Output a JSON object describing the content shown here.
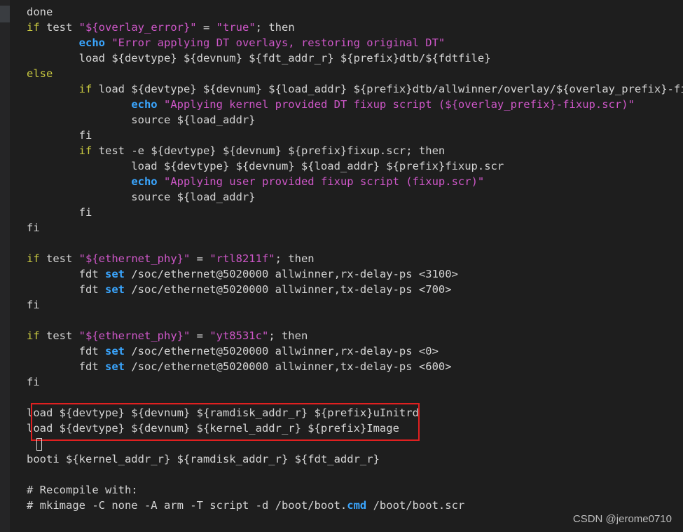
{
  "editor": {
    "lines": [
      [
        {
          "t": "done",
          "c": "plain"
        }
      ],
      [
        {
          "t": "if",
          "c": "kw"
        },
        {
          "t": " test ",
          "c": "plain"
        },
        {
          "t": "\"${overlay_error}\"",
          "c": "str"
        },
        {
          "t": " = ",
          "c": "plain"
        },
        {
          "t": "\"true\"",
          "c": "str"
        },
        {
          "t": "; then",
          "c": "plain"
        }
      ],
      [
        {
          "t": "        ",
          "c": "plain"
        },
        {
          "t": "echo",
          "c": "cmd"
        },
        {
          "t": " ",
          "c": "plain"
        },
        {
          "t": "\"Error applying DT overlays, restoring original DT\"",
          "c": "str"
        }
      ],
      [
        {
          "t": "        load ${devtype} ${devnum} ${fdt_addr_r} ${prefix}dtb/${fdtfile}",
          "c": "plain"
        }
      ],
      [
        {
          "t": "else",
          "c": "kw"
        }
      ],
      [
        {
          "t": "        ",
          "c": "plain"
        },
        {
          "t": "if",
          "c": "kw"
        },
        {
          "t": " load ${devtype} ${devnum} ${load_addr} ${prefix}dtb/allwinner/overlay/${overlay_prefix}-fixup",
          "c": "plain"
        }
      ],
      [
        {
          "t": "                ",
          "c": "plain"
        },
        {
          "t": "echo",
          "c": "cmd"
        },
        {
          "t": " ",
          "c": "plain"
        },
        {
          "t": "\"Applying kernel provided DT fixup script (${overlay_prefix}-fixup.scr)\"",
          "c": "str"
        }
      ],
      [
        {
          "t": "                source ${load_addr}",
          "c": "plain"
        }
      ],
      [
        {
          "t": "        fi",
          "c": "plain"
        }
      ],
      [
        {
          "t": "        ",
          "c": "plain"
        },
        {
          "t": "if",
          "c": "kw"
        },
        {
          "t": " test -e ${devtype} ${devnum} ${prefix}fixup.scr; then",
          "c": "plain"
        }
      ],
      [
        {
          "t": "                load ${devtype} ${devnum} ${load_addr} ${prefix}fixup.scr",
          "c": "plain"
        }
      ],
      [
        {
          "t": "                ",
          "c": "plain"
        },
        {
          "t": "echo",
          "c": "cmd"
        },
        {
          "t": " ",
          "c": "plain"
        },
        {
          "t": "\"Applying user provided fixup script (fixup.scr)\"",
          "c": "str"
        }
      ],
      [
        {
          "t": "                source ${load_addr}",
          "c": "plain"
        }
      ],
      [
        {
          "t": "        fi",
          "c": "plain"
        }
      ],
      [
        {
          "t": "fi",
          "c": "plain"
        }
      ],
      [
        {
          "t": "",
          "c": "plain"
        }
      ],
      [
        {
          "t": "if",
          "c": "kw"
        },
        {
          "t": " test ",
          "c": "plain"
        },
        {
          "t": "\"${ethernet_phy}\"",
          "c": "str"
        },
        {
          "t": " = ",
          "c": "plain"
        },
        {
          "t": "\"rtl8211f\"",
          "c": "str"
        },
        {
          "t": "; then",
          "c": "plain"
        }
      ],
      [
        {
          "t": "        fdt ",
          "c": "plain"
        },
        {
          "t": "set",
          "c": "cmd"
        },
        {
          "t": " /soc/ethernet@5020000 allwinner,rx-delay-ps <3100>",
          "c": "plain"
        }
      ],
      [
        {
          "t": "        fdt ",
          "c": "plain"
        },
        {
          "t": "set",
          "c": "cmd"
        },
        {
          "t": " /soc/ethernet@5020000 allwinner,tx-delay-ps <700>",
          "c": "plain"
        }
      ],
      [
        {
          "t": "fi",
          "c": "plain"
        }
      ],
      [
        {
          "t": "",
          "c": "plain"
        }
      ],
      [
        {
          "t": "if",
          "c": "kw"
        },
        {
          "t": " test ",
          "c": "plain"
        },
        {
          "t": "\"${ethernet_phy}\"",
          "c": "str"
        },
        {
          "t": " = ",
          "c": "plain"
        },
        {
          "t": "\"yt8531c\"",
          "c": "str"
        },
        {
          "t": "; then",
          "c": "plain"
        }
      ],
      [
        {
          "t": "        fdt ",
          "c": "plain"
        },
        {
          "t": "set",
          "c": "cmd"
        },
        {
          "t": " /soc/ethernet@5020000 allwinner,rx-delay-ps <0>",
          "c": "plain"
        }
      ],
      [
        {
          "t": "        fdt ",
          "c": "plain"
        },
        {
          "t": "set",
          "c": "cmd"
        },
        {
          "t": " /soc/ethernet@5020000 allwinner,tx-delay-ps <600>",
          "c": "plain"
        }
      ],
      [
        {
          "t": "fi",
          "c": "plain"
        }
      ],
      [
        {
          "t": "",
          "c": "plain"
        }
      ],
      [
        {
          "t": "load ${devtype} ${devnum} ${ramdisk_addr_r} ${prefix}uInitrd",
          "c": "plain"
        }
      ],
      [
        {
          "t": "load ${devtype} ${devnum} ${kernel_addr_r} ${prefix}Image",
          "c": "plain"
        }
      ],
      [
        {
          "t": "",
          "c": "plain"
        }
      ],
      [
        {
          "t": "booti ${kernel_addr_r} ${ramdisk_addr_r} ${fdt_addr_r}",
          "c": "plain"
        }
      ],
      [
        {
          "t": "",
          "c": "plain"
        }
      ],
      [
        {
          "t": "# Recompile with:",
          "c": "plain"
        }
      ],
      [
        {
          "t": "# mkimage -C none -A arm -T script -d /boot/boot.",
          "c": "plain"
        },
        {
          "t": "cmd",
          "c": "cmd"
        },
        {
          "t": " /boot/boot.scr",
          "c": "plain"
        }
      ]
    ]
  },
  "watermark": "CSDN @jerome0710"
}
